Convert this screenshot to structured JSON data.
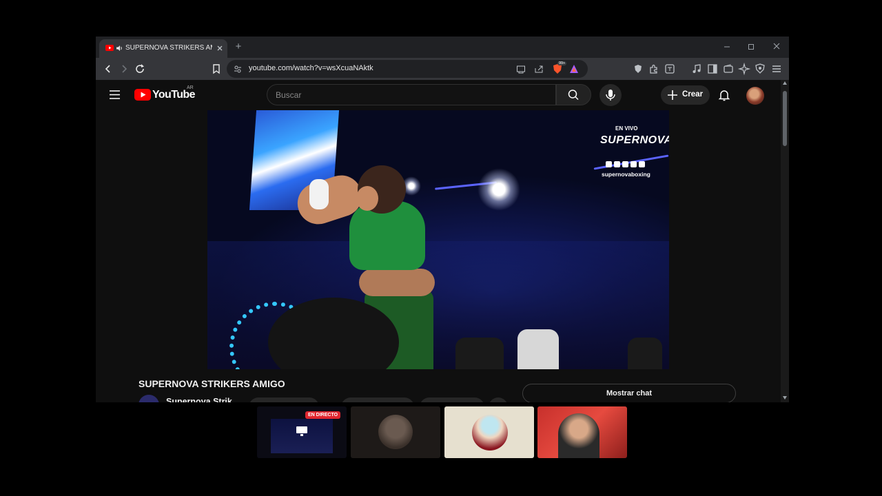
{
  "browser": {
    "tab": {
      "title": "SUPERNOVA STRIKERS AMIGO"
    },
    "url": "youtube.com/watch?v=wsXcuaNAktk",
    "extension_badge": "99+"
  },
  "youtube": {
    "logo_text": "YouTube",
    "region": "AR",
    "search_placeholder": "Buscar",
    "create_label": "Crear"
  },
  "video": {
    "overlay_live": "EN VIVO",
    "overlay_brand": "SUPERNOVA",
    "overlay_handle": "supernovaboxing",
    "title": "SUPERNOVA STRIKERS AMIGO",
    "channel_name": "Supernova Strik",
    "show_chat": "Mostrar chat"
  },
  "participants": {
    "live_badge": "EN DIRECTO"
  },
  "colors": {
    "youtube_red": "#ff0000",
    "live_badge": "#e0262f",
    "window_bg": "#0f0f0f"
  }
}
